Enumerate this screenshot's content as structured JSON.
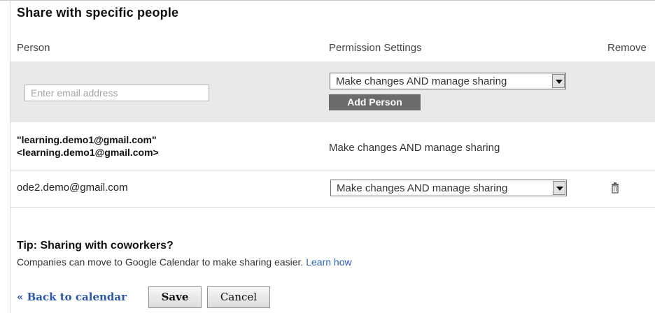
{
  "title": "Share with specific people",
  "headers": {
    "person": "Person",
    "permission": "Permission Settings",
    "remove": "Remove"
  },
  "add_row": {
    "email_placeholder": "Enter email address",
    "permission_selected": "Make changes AND manage sharing",
    "add_button": "Add Person"
  },
  "people": [
    {
      "name_line1": "\"learning.demo1@gmail.com\"",
      "name_line2": "<learning.demo1@gmail.com>",
      "permission": "Make changes AND manage sharing"
    },
    {
      "email": "ode2.demo@gmail.com",
      "permission": "Make changes AND manage sharing",
      "remove_icon": "trash-icon"
    }
  ],
  "tip": {
    "title": "Tip: Sharing with coworkers?",
    "text": "Companies can move to Google Calendar to make sharing easier.",
    "link": "Learn how"
  },
  "footer": {
    "back_link": "« Back to calendar",
    "save": "Save",
    "cancel": "Cancel"
  },
  "colors": {
    "link": "#2a57a8",
    "add_row_bg": "#e9e9e9",
    "add_button_bg": "#6b6b6b"
  }
}
